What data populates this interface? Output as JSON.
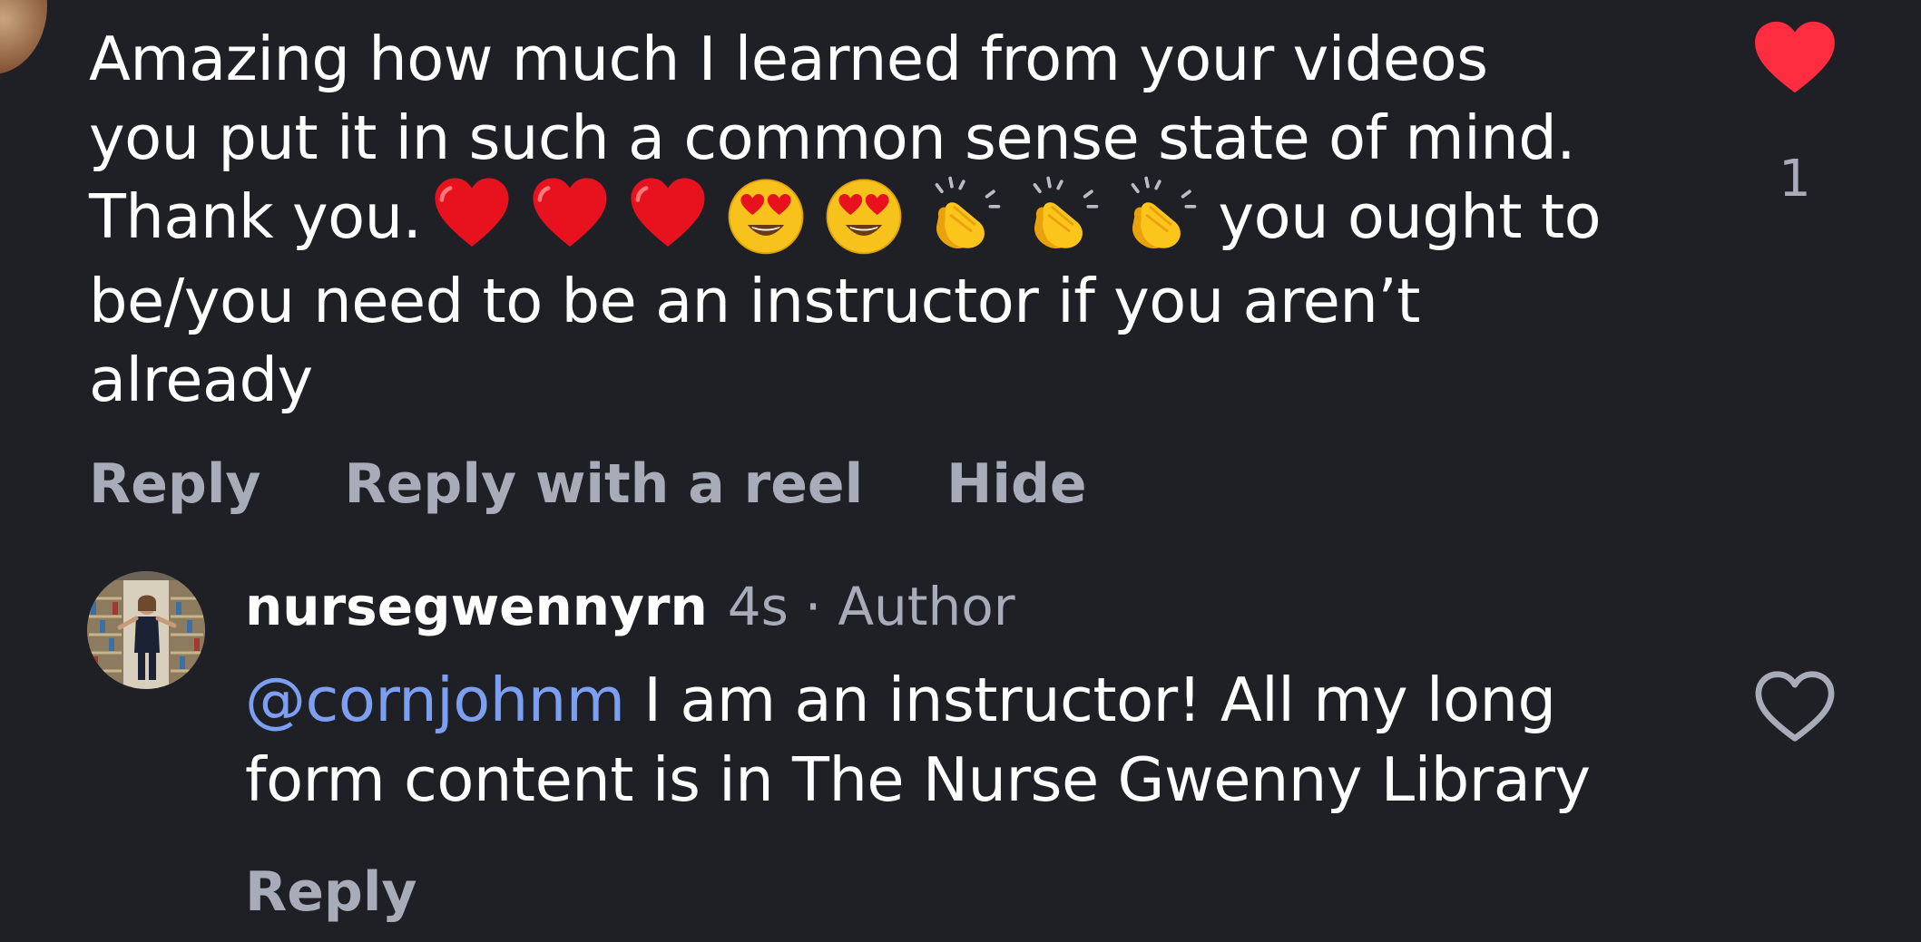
{
  "comment": {
    "text_line1": "Amazing how much I learned from your videos",
    "text_line2": "you put it in such a common sense state of mind.",
    "text_line3_start": "Thank you.",
    "text_line3_end": "you ought to",
    "text_line4": "be/you need to be an instructor if you aren’t",
    "text_line5": "already",
    "emojis": [
      "red-heart",
      "red-heart",
      "red-heart",
      "heart-eyes",
      "heart-eyes",
      "clapping-hands",
      "clapping-hands",
      "clapping-hands"
    ],
    "like_count": "1",
    "liked": true,
    "like_color": "#ff2d3f",
    "actions": {
      "reply": "Reply",
      "reply_with_reel": "Reply with a reel",
      "hide": "Hide"
    }
  },
  "reply": {
    "username": "nursegwennyrn",
    "time": "4s",
    "separator": "·",
    "role": "Author",
    "mention": "@cornjohnm",
    "text_line1": "I am an instructor! All my long",
    "text_line2": "form content is in The Nurse Gwenny Library",
    "liked": false,
    "reply_label": "Reply"
  },
  "colors": {
    "background": "#1f2026",
    "secondary_text": "#a8acb8",
    "mention": "#7d9ff2"
  }
}
